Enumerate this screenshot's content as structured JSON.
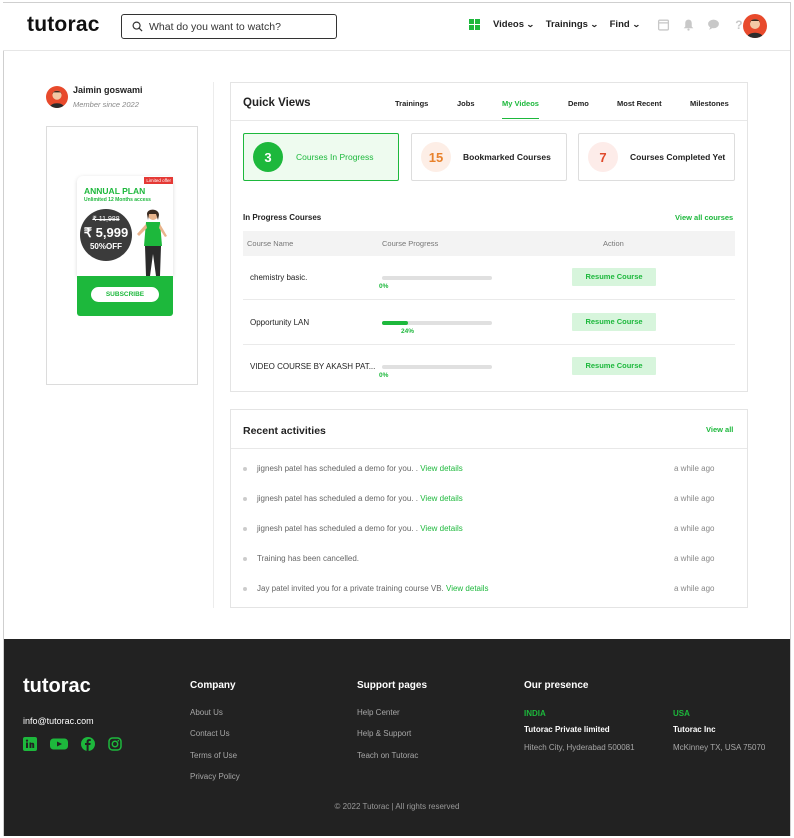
{
  "header": {
    "logo": "tutorac",
    "search_placeholder": "What do you want to watch?",
    "nav": [
      "Videos",
      "Trainings",
      "Find"
    ]
  },
  "profile": {
    "name": "Jaimin goswami",
    "member_since": "Member since 2022"
  },
  "promo": {
    "badge": "Limited offer",
    "plan": "ANNUAL PLAN",
    "subtitle": "Unlimited 12 Months access",
    "old_price": "₹ 11,988",
    "new_price": "₹ 5,999",
    "discount": "50%OFF",
    "button": "SUBSCRIBE"
  },
  "quick_views": {
    "title": "Quick Views",
    "tabs": [
      "Trainings",
      "Jobs",
      "My Videos",
      "Demo",
      "Most Recent",
      "Milestones"
    ],
    "active_tab": "My Videos",
    "cards": [
      {
        "count": "3",
        "label": "Courses In Progress"
      },
      {
        "count": "15",
        "label": "Bookmarked Courses"
      },
      {
        "count": "7",
        "label": "Courses Completed Yet"
      }
    ],
    "in_progress_title": "In Progress Courses",
    "view_all": "View all courses",
    "columns": [
      "Course Name",
      "Course Progress",
      "Action"
    ],
    "rows": [
      {
        "name": "chemistry basic.",
        "progress": "0%",
        "progress_value": 0,
        "action": "Resume Course"
      },
      {
        "name": "Opportunity LAN",
        "progress": "24%",
        "progress_value": 24,
        "action": "Resume Course"
      },
      {
        "name": "VIDEO COURSE BY AKASH PAT...",
        "progress": "0%",
        "progress_value": 0,
        "action": "Resume Course"
      }
    ]
  },
  "recent": {
    "title": "Recent activities",
    "view_all": "View all",
    "items": [
      {
        "text": "jignesh patel has scheduled a demo for you. .",
        "link": "View details",
        "time": "a while ago"
      },
      {
        "text": "jignesh patel has scheduled a demo for you. .",
        "link": "View details",
        "time": "a while ago"
      },
      {
        "text": "jignesh patel has scheduled a demo for you. .",
        "link": "View details",
        "time": "a while ago"
      },
      {
        "text": "Training has been cancelled.",
        "link": "",
        "time": "a while ago"
      },
      {
        "text": "Jay patel invited you for a private training course VB.",
        "link": "View details",
        "time": "a while ago"
      }
    ]
  },
  "footer": {
    "logo": "tutorac",
    "email": "info@tutorac.com",
    "company_title": "Company",
    "company_links": [
      "About Us",
      "Contact Us",
      "Terms of Use",
      "Privacy Policy"
    ],
    "support_title": "Support pages",
    "support_links": [
      "Help Center",
      "Help & Support",
      "Teach on Tutorac"
    ],
    "presence_title": "Our presence",
    "presence": [
      {
        "country": "INDIA",
        "company": "Tutorac Private limited",
        "address": "Hitech City, Hyderabad 500081"
      },
      {
        "country": "USA",
        "company": "Tutorac Inc",
        "address": "McKinney TX, USA 75070"
      }
    ],
    "copyright": "© 2022 Tutorac | All rights reserved"
  },
  "colors": {
    "accent": "#1db83c",
    "footer_bg": "#222222"
  }
}
